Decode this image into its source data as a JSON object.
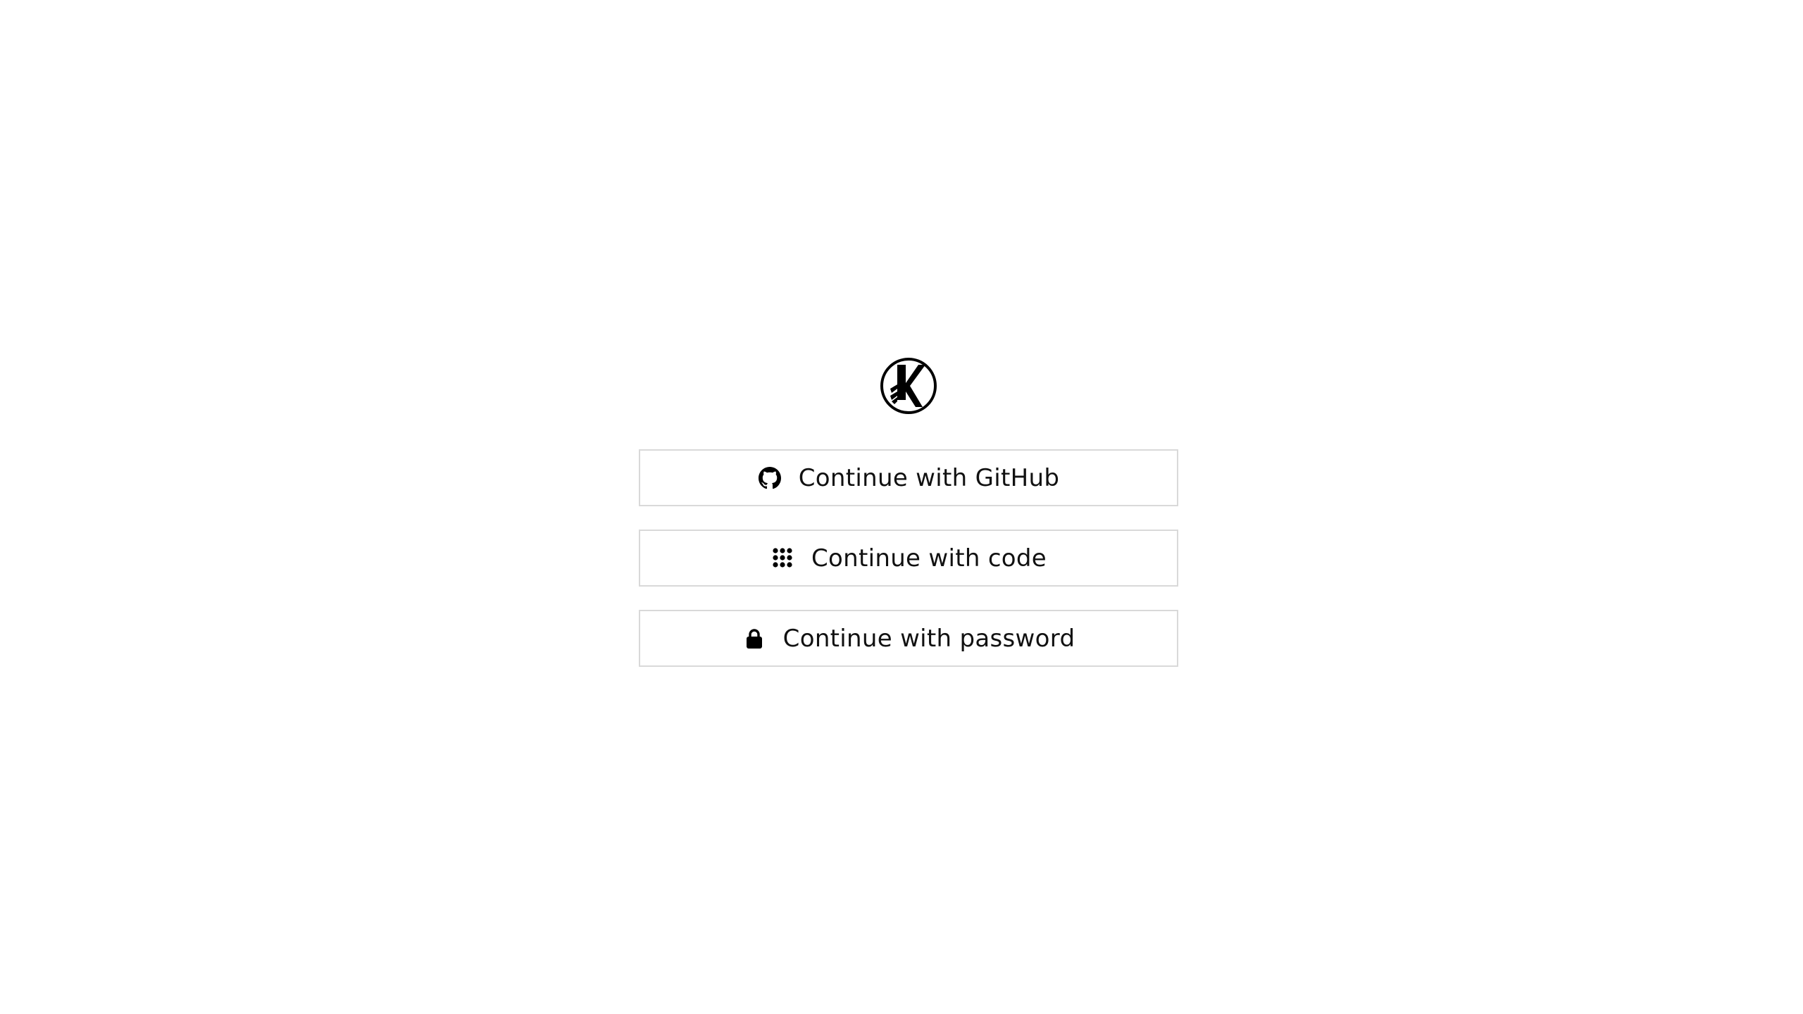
{
  "logo": {
    "icon": "k-circle-logo",
    "color": "#000000"
  },
  "auth_buttons": [
    {
      "label": "Continue with GitHub",
      "icon": "github-icon"
    },
    {
      "label": "Continue with code",
      "icon": "keypad-icon"
    },
    {
      "label": "Continue with password",
      "icon": "lock-icon"
    }
  ],
  "colors": {
    "background": "#ffffff",
    "button_border": "#d9d9d9",
    "text": "#111111"
  }
}
